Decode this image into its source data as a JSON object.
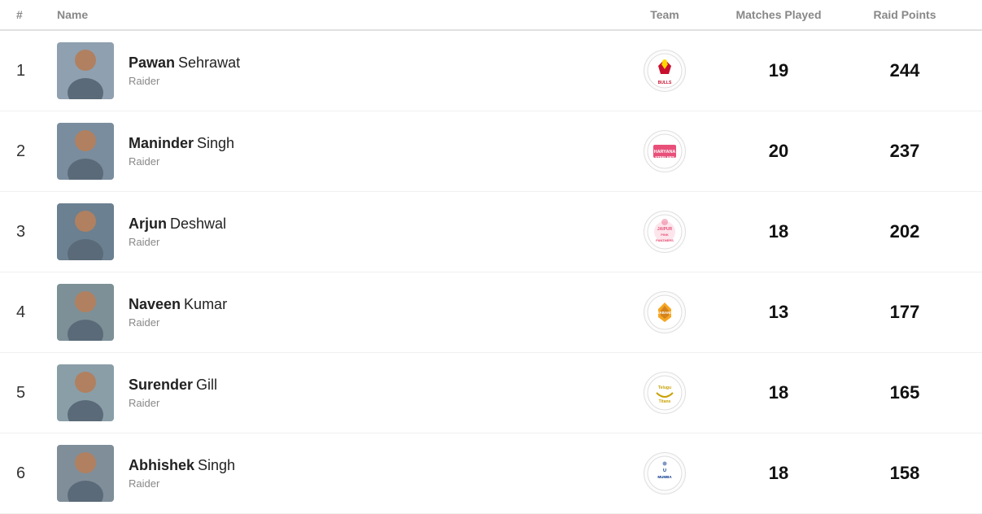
{
  "header": {
    "rank_label": "#",
    "name_label": "Name",
    "team_label": "Team",
    "matches_label": "Matches Played",
    "points_label": "Raid Points"
  },
  "players": [
    {
      "rank": "1",
      "first_name": "Pawan",
      "last_name": "Sehrawat",
      "role": "Raider",
      "team": "Bengaluru Bulls",
      "team_key": "bengaluru",
      "matches": "19",
      "points": "244"
    },
    {
      "rank": "2",
      "first_name": "Maninder",
      "last_name": "Singh",
      "role": "Raider",
      "team": "Haryana Steelers",
      "team_key": "haryana",
      "matches": "20",
      "points": "237"
    },
    {
      "rank": "3",
      "first_name": "Arjun",
      "last_name": "Deshwal",
      "role": "Raider",
      "team": "Jaipur Pink Panthers",
      "team_key": "jaipur",
      "matches": "18",
      "points": "202"
    },
    {
      "rank": "4",
      "first_name": "Naveen",
      "last_name": "Kumar",
      "role": "Raider",
      "team": "Dabang Delhi",
      "team_key": "dabang",
      "matches": "13",
      "points": "177"
    },
    {
      "rank": "5",
      "first_name": "Surender",
      "last_name": "Gill",
      "role": "Raider",
      "team": "Telugu Titans",
      "team_key": "telugu",
      "matches": "18",
      "points": "165"
    },
    {
      "rank": "6",
      "first_name": "Abhishek",
      "last_name": "Singh",
      "role": "Raider",
      "team": "U Mumba",
      "team_key": "mumbai",
      "matches": "18",
      "points": "158"
    }
  ]
}
